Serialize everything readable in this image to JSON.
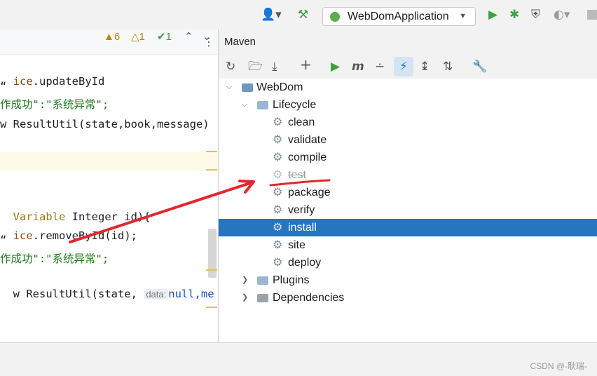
{
  "toolbar": {
    "user_icon": "user-icon",
    "build_icon": "hammer-icon",
    "run_config": "WebDomApplication",
    "run_icon": "play-icon",
    "debug_icon": "bug-icon",
    "coverage_icon": "shield-icon",
    "profile_icon": "profile-icon",
    "stop_icon": "stop-icon"
  },
  "editor": {
    "lines": [
      {
        "text": "ice.updateById",
        "color": "#1e1e1e"
      },
      {
        "text": "“",
        "color": "#1e1e1e"
      },
      {
        "text": "作成功\":\"系统异常\";",
        "color": "#1f7a1f"
      },
      {
        "text": "w ResultUtil(state,book,message)",
        "color": "#1e1e1e"
      },
      {
        "text": "Variable Integer id){",
        "color": "#1e1e1e"
      },
      {
        "text": "ice.removeById(id);",
        "color": "#1e1e1e"
      },
      {
        "text": "“",
        "color": "#1e1e1e"
      },
      {
        "text": "作成功\":\"系统异常\";",
        "color": "#1f7a1f"
      },
      {
        "text": "w ResultUtil(state, ",
        "color": "#1e1e1e"
      }
    ],
    "hint_label": "data:",
    "line9_rest": "null,me",
    "warnings": "6",
    "weak_warnings": "1",
    "typos": "1"
  },
  "maven": {
    "title": "Maven",
    "tree": [
      {
        "label": "WebDom",
        "level": 0,
        "kind": "project",
        "chevron": "expanded"
      },
      {
        "label": "Lifecycle",
        "level": 1,
        "kind": "folder",
        "chevron": "expanded"
      },
      {
        "label": "clean",
        "level": 2,
        "kind": "goal"
      },
      {
        "label": "validate",
        "level": 2,
        "kind": "goal"
      },
      {
        "label": "compile",
        "level": 2,
        "kind": "goal"
      },
      {
        "label": "test",
        "level": 2,
        "kind": "goal",
        "skipped": true
      },
      {
        "label": "package",
        "level": 2,
        "kind": "goal"
      },
      {
        "label": "verify",
        "level": 2,
        "kind": "goal"
      },
      {
        "label": "install",
        "level": 2,
        "kind": "goal",
        "selected": true
      },
      {
        "label": "site",
        "level": 2,
        "kind": "goal"
      },
      {
        "label": "deploy",
        "level": 2,
        "kind": "goal"
      },
      {
        "label": "Plugins",
        "level": 1,
        "kind": "folder",
        "chevron": "collapsed"
      },
      {
        "label": "Dependencies",
        "level": 1,
        "kind": "folder",
        "chevron": "collapsed"
      }
    ]
  },
  "watermark": "CSDN @-耿瑞-",
  "colors": {
    "selection": "#2675bf",
    "annotation": "#e0282e",
    "run_green": "#39a33c"
  }
}
